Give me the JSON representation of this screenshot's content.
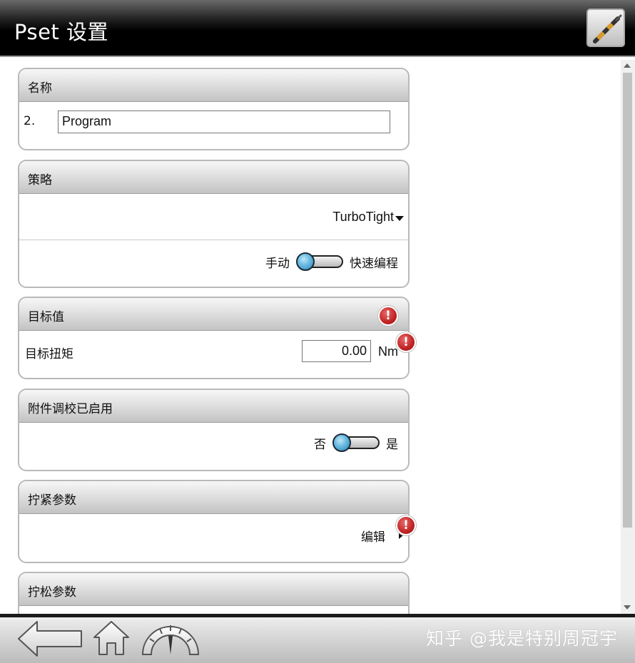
{
  "header": {
    "title": "Pset 设置",
    "tool_icon": "screwdriver-tool-icon"
  },
  "panels": {
    "name": {
      "title": "名称",
      "number": "2.",
      "value": "Program"
    },
    "strategy": {
      "title": "策略",
      "selected": "TurboTight",
      "toggle_left": "手动",
      "toggle_right": "快速编程",
      "toggle_on": false
    },
    "target": {
      "title": "目标值",
      "field_label": "目标扭矩",
      "value": "0.00",
      "unit": "Nm",
      "warning_symbol": "!"
    },
    "accessory": {
      "title": "附件调校已启用",
      "toggle_left": "否",
      "toggle_right": "是",
      "toggle_on": false
    },
    "tightening": {
      "title": "拧紧参数",
      "edit_label": "编辑",
      "warning_symbol": "!"
    },
    "loosening": {
      "title": "拧松参数"
    }
  },
  "footer": {
    "icons": [
      "back-arrow-icon",
      "home-icon",
      "gauge-icon"
    ],
    "watermark": "知乎 @我是特别周冠宇"
  },
  "colors": {
    "warning": "#c02323",
    "toggle_knob": "#4aa3d3",
    "header_bg": "#000000"
  }
}
